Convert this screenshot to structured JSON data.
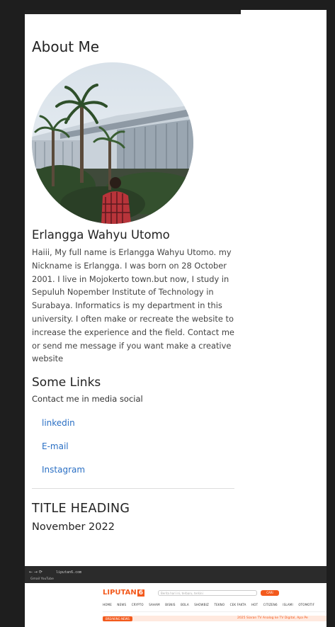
{
  "about": {
    "title": "About Me",
    "name": "Erlangga Wahyu Utomo",
    "bio": "Haiii, My full name is Erlangga Wahyu Utomo. my Nickname is Erlangga. I was born on 28 October 2001. I live in Mojokerto town.but now, I study in Sepuluh Nopember Institute of Technology in Surabaya. Informatics is my department in this university. I often make or recreate the website to increase the experience and the field. Contact me or send me message if you want make a creative website"
  },
  "links": {
    "title": "Some Links",
    "subtitle": "Contact me in media social",
    "items": [
      {
        "label": "linkedin"
      },
      {
        "label": "E-mail"
      },
      {
        "label": "Instagram"
      }
    ]
  },
  "post": {
    "title": "TITLE HEADING",
    "date": "November 2022"
  },
  "screenshot": {
    "url": "liputan6.com",
    "bookmarks": "Gmail  YouTube",
    "logo": "LIPUTAN",
    "logo_badge": "6",
    "search_placeholder": "Berita hari ini, terbaru, terkini",
    "search_button": "CARI",
    "menu": [
      "HOME",
      "NEWS",
      "CRYPTO",
      "SAHAM",
      "BISNIS",
      "BOLA",
      "SHOWBIZ",
      "TEKNO",
      "CEK FAKTA",
      "HOT",
      "CITIZEN6",
      "ISLAMI",
      "OTOMOTIF"
    ],
    "badge": "BREAKING NEWS",
    "ticker": "2025 Siaran TV Analog ke TV Digital, Apa Pe"
  },
  "colors": {
    "link": "#2a6fc4",
    "brand": "#f35a1d"
  }
}
